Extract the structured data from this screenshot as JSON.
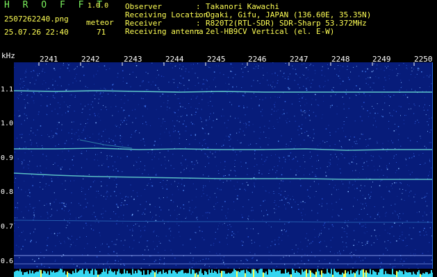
{
  "header": {
    "app_title": "H R O F F T",
    "version": "1.0.0",
    "filename": "2507262240.png",
    "datetime": "25.07.26 22:40",
    "meteor_label": "meteor",
    "meteor_count": "71"
  },
  "info": [
    {
      "label": "Observer",
      "value": "Takanori Kawachi"
    },
    {
      "label": "Receiving Location",
      "value": "Ogaki, Gifu, JAPAN (136.60E, 35.35N)"
    },
    {
      "label": "Receiver",
      "value": "R820T2(RTL-SDR) SDR-Sharp 53.372MHz"
    },
    {
      "label": "Receiving antenna",
      "value": "2el-HB9CV Vertical (el. E-W)"
    }
  ],
  "colon": ":",
  "axis": {
    "y_unit": "kHz",
    "y_ticks": [
      "1.1",
      "1.0",
      "0.9",
      "0.8",
      "0.7",
      "0.6"
    ],
    "x_ticks": [
      "2241",
      "2242",
      "2243",
      "2244",
      "2245",
      "2246",
      "2247",
      "2248",
      "2249",
      "2250"
    ]
  },
  "colors": {
    "background": "#000000",
    "header_green": "#7cf35e",
    "header_yellow": "#ffff55",
    "spectrogram_base": "#071c7a",
    "trace": "#6fe8d8"
  }
}
